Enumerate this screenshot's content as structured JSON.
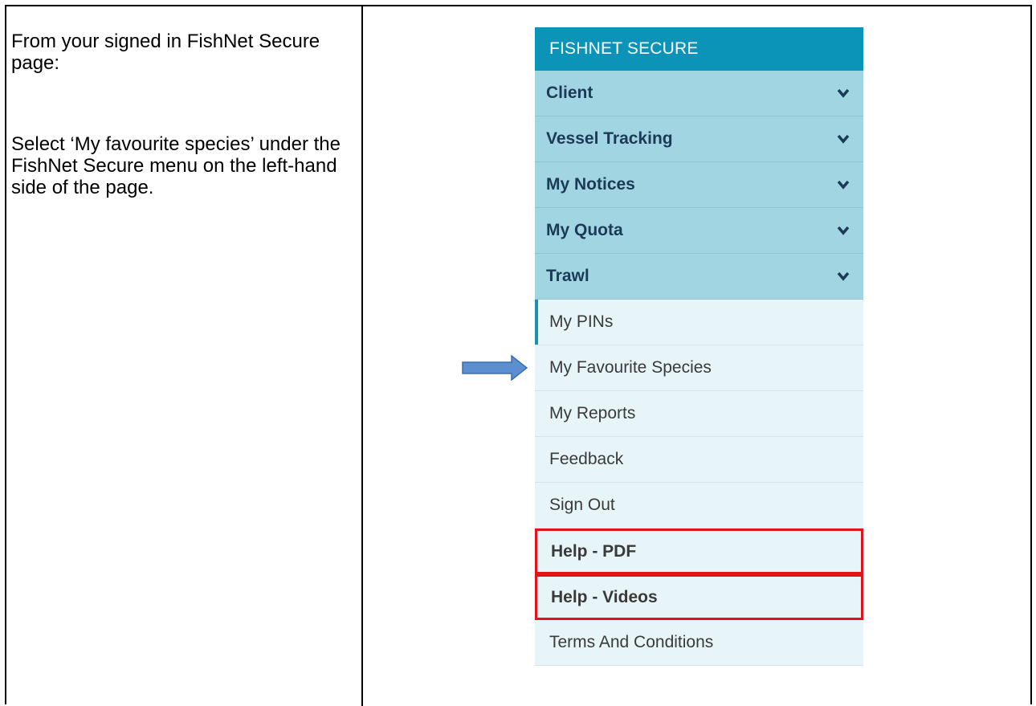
{
  "instructions": {
    "line1": "From your signed in FishNet Secure page:",
    "line2": "Select ‘My favourite species’ under the FishNet Secure menu on the left-hand side of the page."
  },
  "menu": {
    "header": "FISHNET SECURE",
    "groups": [
      {
        "label": "Client"
      },
      {
        "label": "Vessel Tracking"
      },
      {
        "label": "My Notices"
      },
      {
        "label": "My Quota"
      },
      {
        "label": "Trawl"
      }
    ],
    "items": [
      {
        "label": "My PINs"
      },
      {
        "label": "My Favourite Species"
      },
      {
        "label": "My Reports"
      },
      {
        "label": "Feedback"
      },
      {
        "label": "Sign Out"
      },
      {
        "label": "Help - PDF"
      },
      {
        "label": "Help - Videos"
      },
      {
        "label": "Terms And Conditions"
      }
    ]
  },
  "colors": {
    "header_bg": "#0c94b8",
    "group_bg": "#a2d5e2",
    "item_bg": "#e7f4f8",
    "highlight_border": "#e0141b",
    "arrow_fill": "#5b8fd0"
  },
  "icons": {
    "group_chevron": "chevron-down-icon",
    "pointer": "right-arrow-icon"
  }
}
